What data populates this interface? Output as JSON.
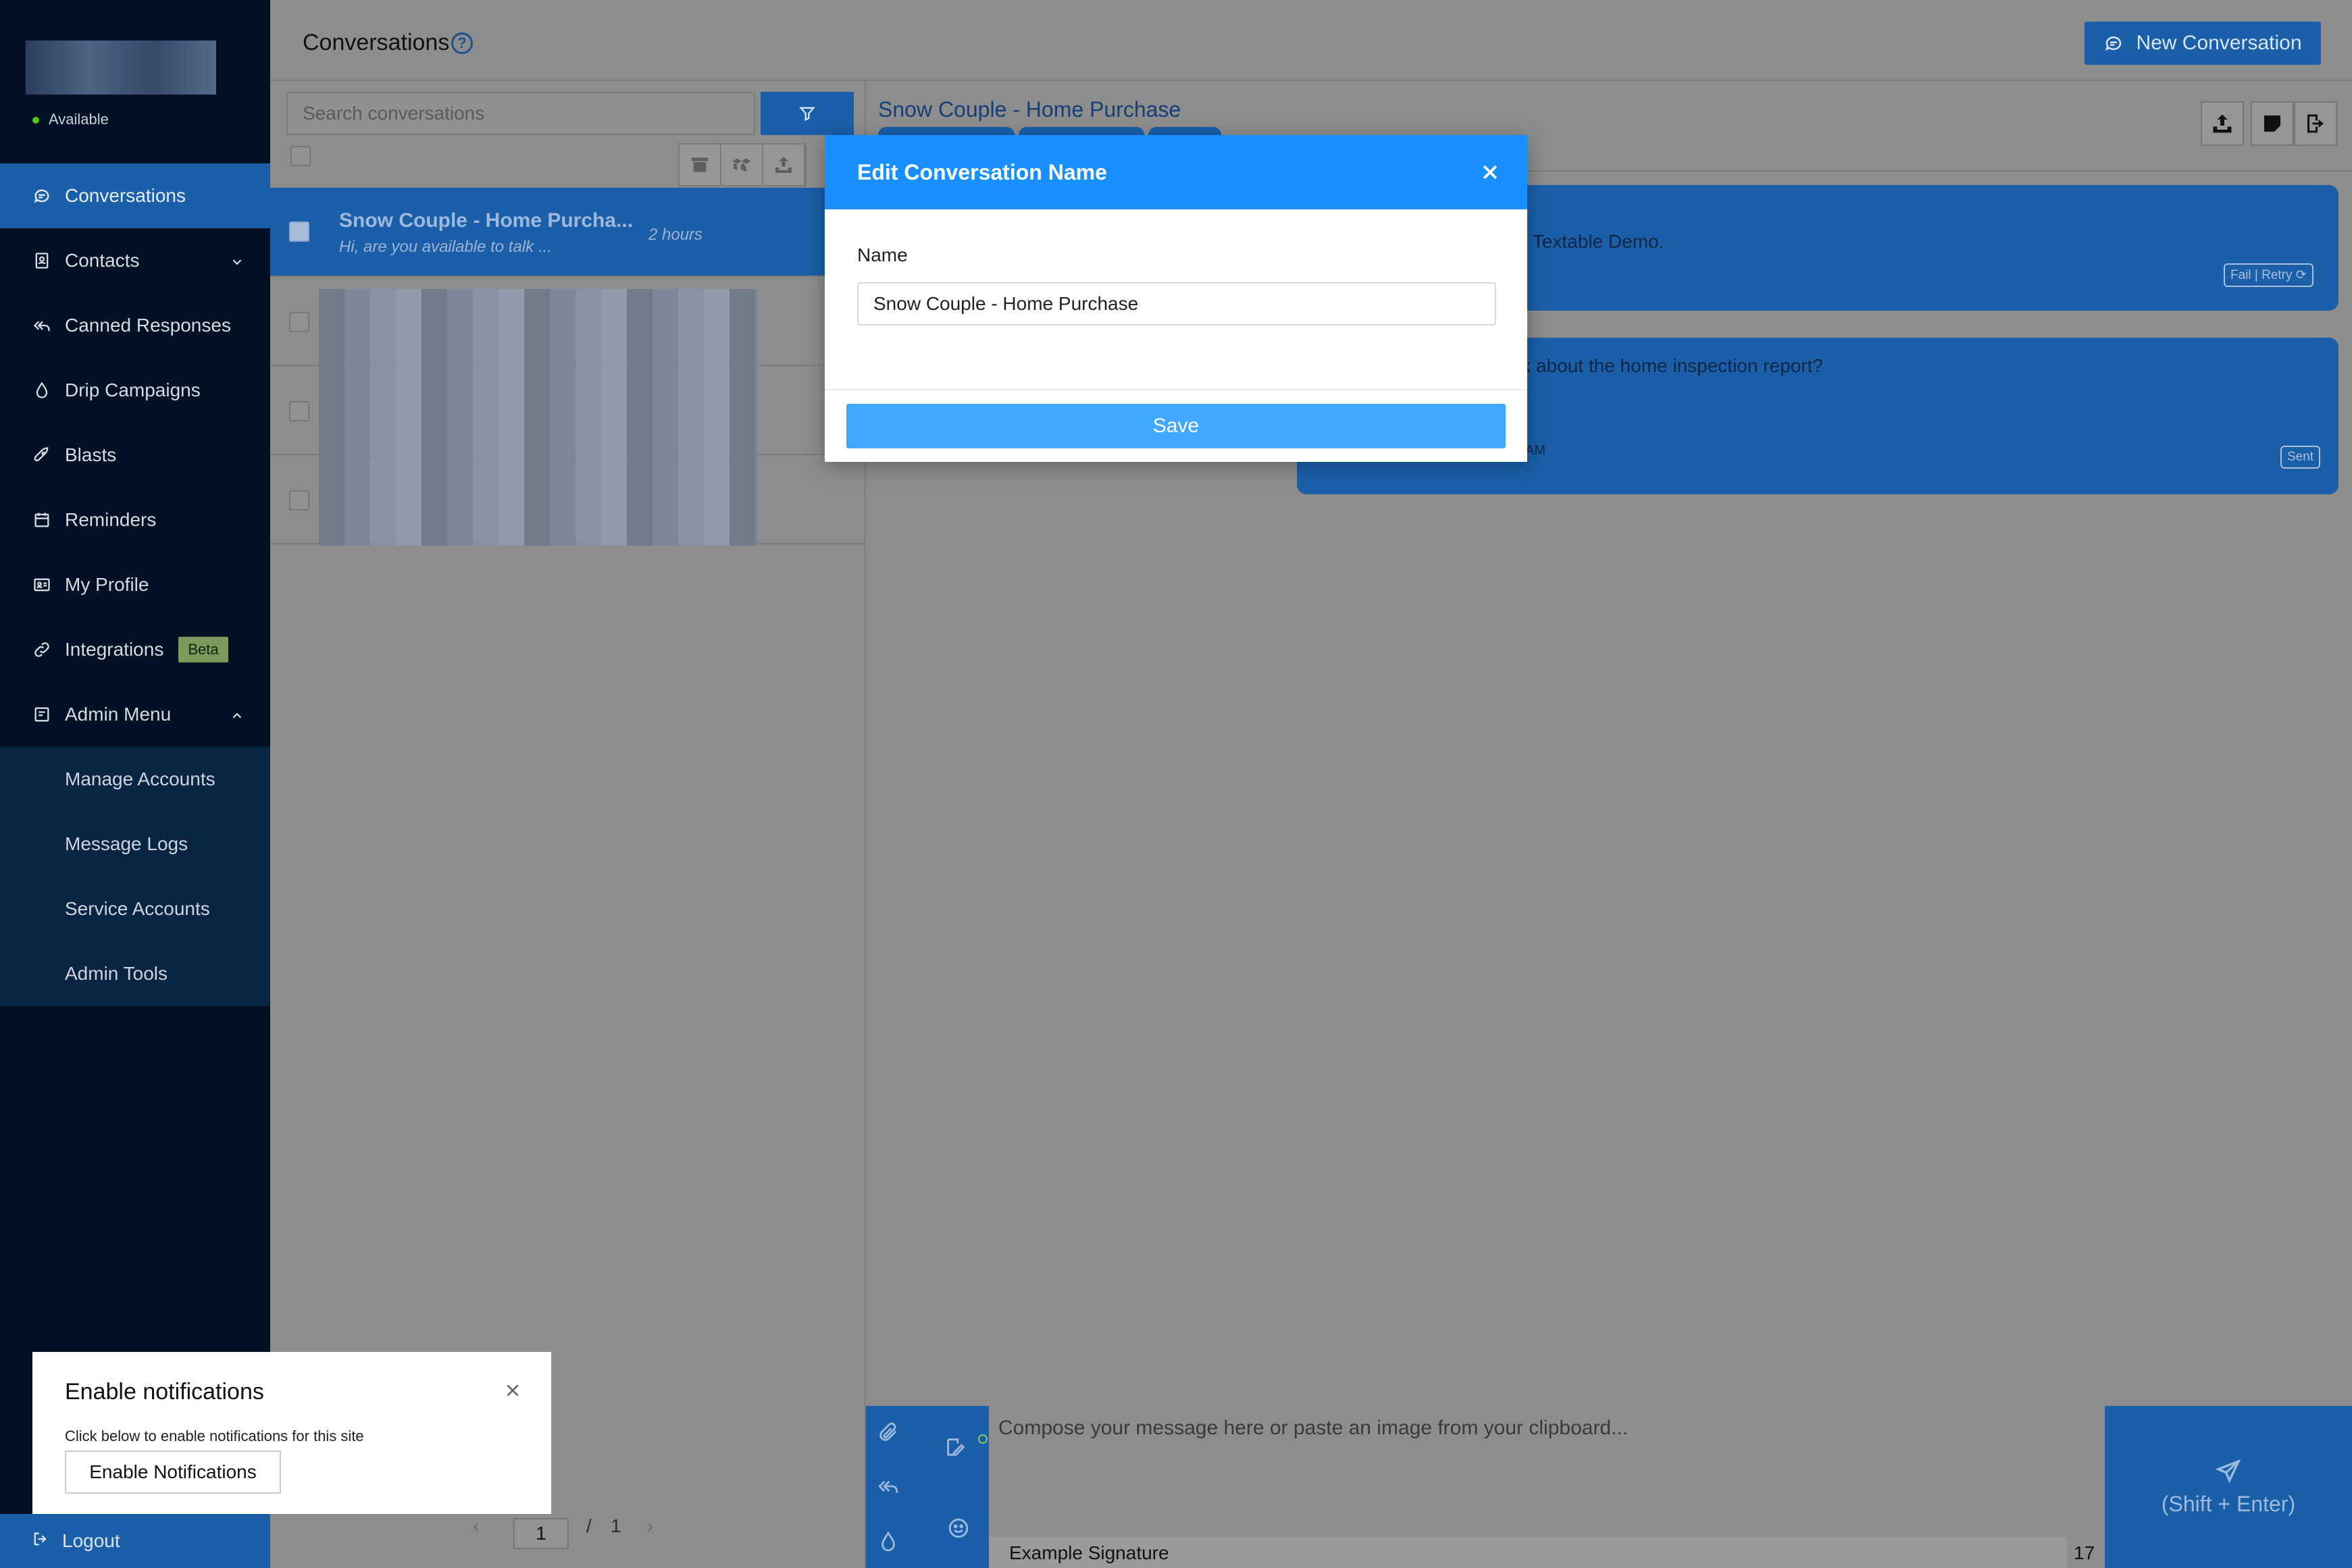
{
  "sidebar": {
    "status": "Available",
    "items": [
      {
        "label": "Conversations",
        "icon": "chat-icon"
      },
      {
        "label": "Contacts",
        "icon": "contacts-icon"
      },
      {
        "label": "Canned Responses",
        "icon": "reply-all-icon"
      },
      {
        "label": "Drip Campaigns",
        "icon": "drop-icon"
      },
      {
        "label": "Blasts",
        "icon": "rocket-icon"
      },
      {
        "label": "Reminders",
        "icon": "calendar-icon"
      },
      {
        "label": "My Profile",
        "icon": "id-card-icon"
      },
      {
        "label": "Integrations",
        "icon": "link-icon",
        "badge": "Beta"
      },
      {
        "label": "Admin Menu",
        "icon": "admin-icon"
      }
    ],
    "admin_submenu": [
      "Manage Accounts",
      "Message Logs",
      "Service Accounts",
      "Admin Tools"
    ],
    "logout": "Logout"
  },
  "header": {
    "title": "Conversations",
    "help": "?",
    "new_conversation": "New Conversation"
  },
  "list": {
    "search_placeholder": "Search conversations",
    "conversations": [
      {
        "name": "Snow Couple - Home Purcha...",
        "preview": "Hi, are you available to talk ...",
        "time": "2 hours"
      }
    ],
    "pagination": {
      "current": "1",
      "separator": "/",
      "total": "1"
    }
  },
  "chat": {
    "title": "Snow Couple - Home Purchase",
    "messages": [
      {
        "text": "a Textable Demo.",
        "status": "Fail | Retry"
      },
      {
        "text": "lk about the home inspection report?",
        "time": "AM",
        "status": "Sent"
      }
    ],
    "composer_placeholder": "Compose your message here or paste an image from your clipboard...",
    "signature": "Example Signature",
    "char_count": "17",
    "send_hint": "(Shift + Enter)"
  },
  "modal": {
    "title": "Edit Conversation Name",
    "name_label": "Name",
    "name_value": "Snow Couple - Home Purchase",
    "save": "Save"
  },
  "notification": {
    "title": "Enable notifications",
    "description": "Click below to enable notifications for this site",
    "button": "Enable Notifications"
  },
  "colors": {
    "sidebar_bg": "#021023",
    "accent": "#1890ff",
    "active_blue": "#1a5fa8",
    "status_green": "#52c41a"
  }
}
